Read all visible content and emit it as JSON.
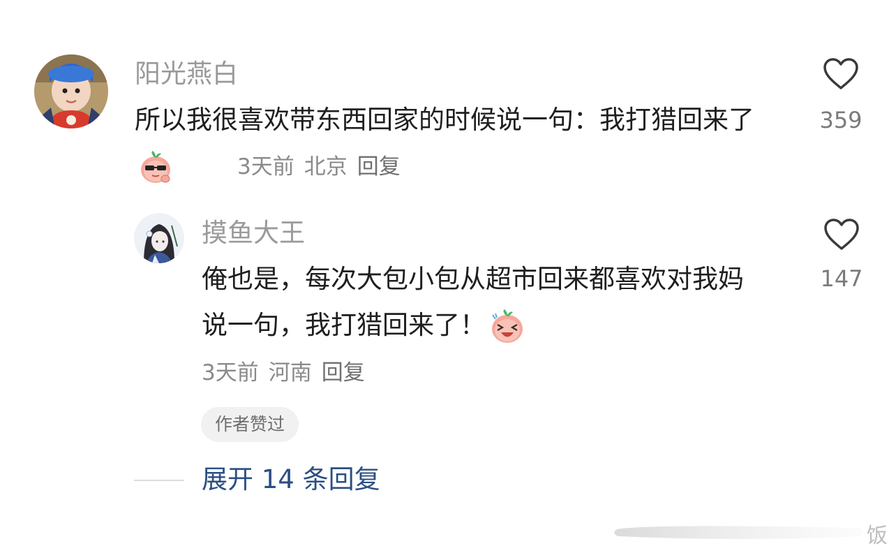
{
  "comment": {
    "username": "阳光燕白",
    "text": "所以我很喜欢带东西回家的时候说一句：我打猎回来了",
    "emoji": "sunglasses-peach-emoji",
    "time": "3天前",
    "location": "北京",
    "reply_label": "回复",
    "like_count": "359",
    "reply": {
      "username": "摸鱼大王",
      "text": "俺也是，每次大包小包从超市回来都喜欢对我妈说一句，我打猎回来了！",
      "emoji": "laughing-peach-emoji",
      "time": "3天前",
      "location": "河南",
      "reply_label": "回复",
      "like_count": "147",
      "badge": "作者赞过"
    },
    "expand_label": "展开 14 条回复"
  },
  "watermark": {
    "text": "饭"
  },
  "colors": {
    "link": "#2b4f82",
    "meta": "#8a8a8a",
    "username": "#9a9a9a"
  }
}
